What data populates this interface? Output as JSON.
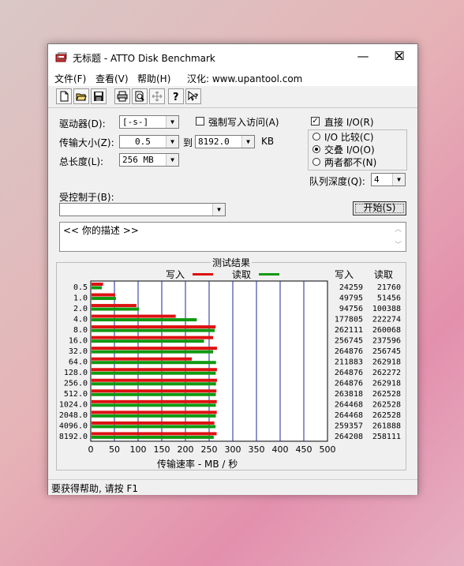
{
  "window": {
    "title": "无标题 - ATTO Disk Benchmark",
    "min_label": "—",
    "max_label": "☐",
    "close_label": "✕"
  },
  "menu": {
    "file": "文件(F)",
    "view": "查看(V)",
    "help": "帮助(H)",
    "credit": "汉化: www.upantool.com"
  },
  "toolbar": {
    "icons": [
      "new-file-icon",
      "open-folder-icon",
      "save-icon",
      "print-icon",
      "print-preview-icon",
      "move-icon",
      "help-icon",
      "context-help-icon"
    ]
  },
  "settings": {
    "drive_label": "驱动器(D):",
    "drive_value": "[-s-]",
    "force_write_label": "强制写入访问(A)",
    "force_write_checked": false,
    "transfer_label": "传输大小(Z):",
    "transfer_from": "0.5",
    "to_label": "到",
    "transfer_to": "8192.0",
    "kb_label": "KB",
    "length_label": "总长度(L):",
    "length_value": "256 MB",
    "direct_io_label": "直接 I/O(R)",
    "direct_io_checked": true,
    "io_compare_label": "I/O 比较(C)",
    "overlapped_io_label": "交叠 I/O(O)",
    "neither_label": "两者都不(N)",
    "selected_io_mode": "overlapped",
    "queue_label": "队列深度(Q):",
    "queue_value": "4",
    "controlled_by_label": "受控制于(B):",
    "controlled_by_value": "",
    "start_label": "开始(S)",
    "description": "<<  你的描述   >>"
  },
  "results": {
    "title": "测试结果",
    "write_legend": "写入",
    "read_legend": "读取",
    "write_col": "写入",
    "read_col": "读取",
    "xlabel": "传输速率 - MB / 秒"
  },
  "chart_data": {
    "type": "bar",
    "orientation": "horizontal",
    "title": "测试结果",
    "xlabel": "传输速率 - MB / 秒",
    "xlim": [
      0,
      500
    ],
    "xticks": [
      "0",
      "50",
      "100",
      "150",
      "200",
      "250",
      "300",
      "350",
      "400",
      "450",
      "500"
    ],
    "categories": [
      "0.5",
      "1.0",
      "2.0",
      "4.0",
      "8.0",
      "16.0",
      "32.0",
      "64.0",
      "128.0",
      "256.0",
      "512.0",
      "1024.0",
      "2048.0",
      "4096.0",
      "8192.0"
    ],
    "series": [
      {
        "name": "写入",
        "color": "#dd1111",
        "values_kb": [
          "24259",
          "49795",
          "94756",
          "177805",
          "262111",
          "256745",
          "264876",
          "211883",
          "264876",
          "264876",
          "263818",
          "264468",
          "264468",
          "259357",
          "264208"
        ],
        "values": [
          24.3,
          49.8,
          94.8,
          177.8,
          262.1,
          256.7,
          264.9,
          211.9,
          264.9,
          264.9,
          263.8,
          264.5,
          264.5,
          259.4,
          264.2
        ]
      },
      {
        "name": "读取",
        "color": "#119911",
        "values_kb": [
          "21760",
          "51456",
          "100388",
          "222274",
          "260068",
          "237596",
          "256745",
          "262918",
          "262272",
          "262918",
          "262528",
          "262528",
          "262528",
          "261888",
          "258111"
        ],
        "values": [
          21.8,
          51.5,
          100.4,
          222.3,
          260.1,
          237.6,
          256.7,
          262.9,
          262.3,
          262.9,
          262.5,
          262.5,
          262.5,
          261.9,
          258.1
        ]
      }
    ],
    "legend": "top",
    "grid": true
  },
  "status": {
    "text": "要获得帮助, 请按 F1"
  }
}
